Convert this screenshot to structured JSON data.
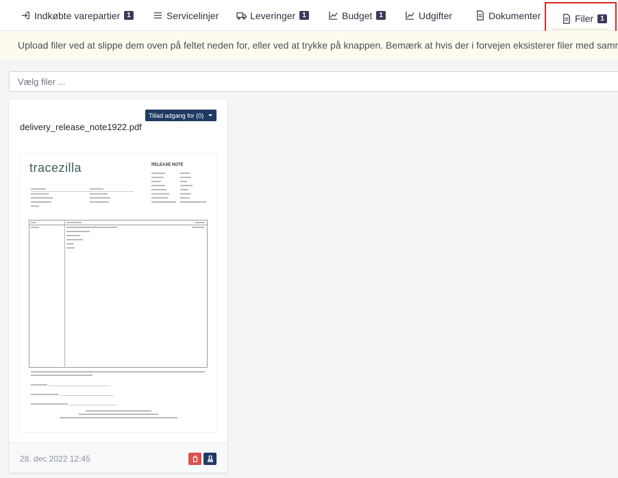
{
  "tabs": [
    {
      "id": "indkobte",
      "label": "Indkøbte varepartier",
      "badge": "1",
      "icon": "login-icon"
    },
    {
      "id": "servicelinjer",
      "label": "Servicelinjer",
      "badge": "",
      "icon": "list-icon"
    },
    {
      "id": "leveringer",
      "label": "Leveringer",
      "badge": "1",
      "icon": "truck-icon"
    },
    {
      "id": "budget",
      "label": "Budget",
      "badge": "1",
      "icon": "chart-line-icon"
    },
    {
      "id": "udgifter",
      "label": "Udgifter",
      "badge": "",
      "icon": "chart-line-icon"
    },
    {
      "id": "dokumenter",
      "label": "Dokumenter",
      "badge": "",
      "icon": "document-icon"
    },
    {
      "id": "filer",
      "label": "Filer",
      "badge": "1",
      "icon": "document-icon",
      "active": true
    }
  ],
  "notice": "Upload filer ved at slippe dem oven på feltet neden for, eller ved at trykke på knappen. Bemærk at hvis der i forvejen eksisterer filer med samme navn",
  "file_input": {
    "placeholder": "Vælg filer ..."
  },
  "file_card": {
    "access_button": "Tillad adgang for (0)",
    "filename": "delivery_release_note1922.pdf",
    "preview": {
      "logo": "tracezilla",
      "heading": "RELEASE NOTE"
    },
    "date": "28. dec 2022 12:45"
  },
  "colors": {
    "badge": "#3f3a5c",
    "navy": "#1f3a63",
    "danger": "#d9534f",
    "notice_bg": "#fdfbee",
    "active_outline": "#d9261c"
  }
}
